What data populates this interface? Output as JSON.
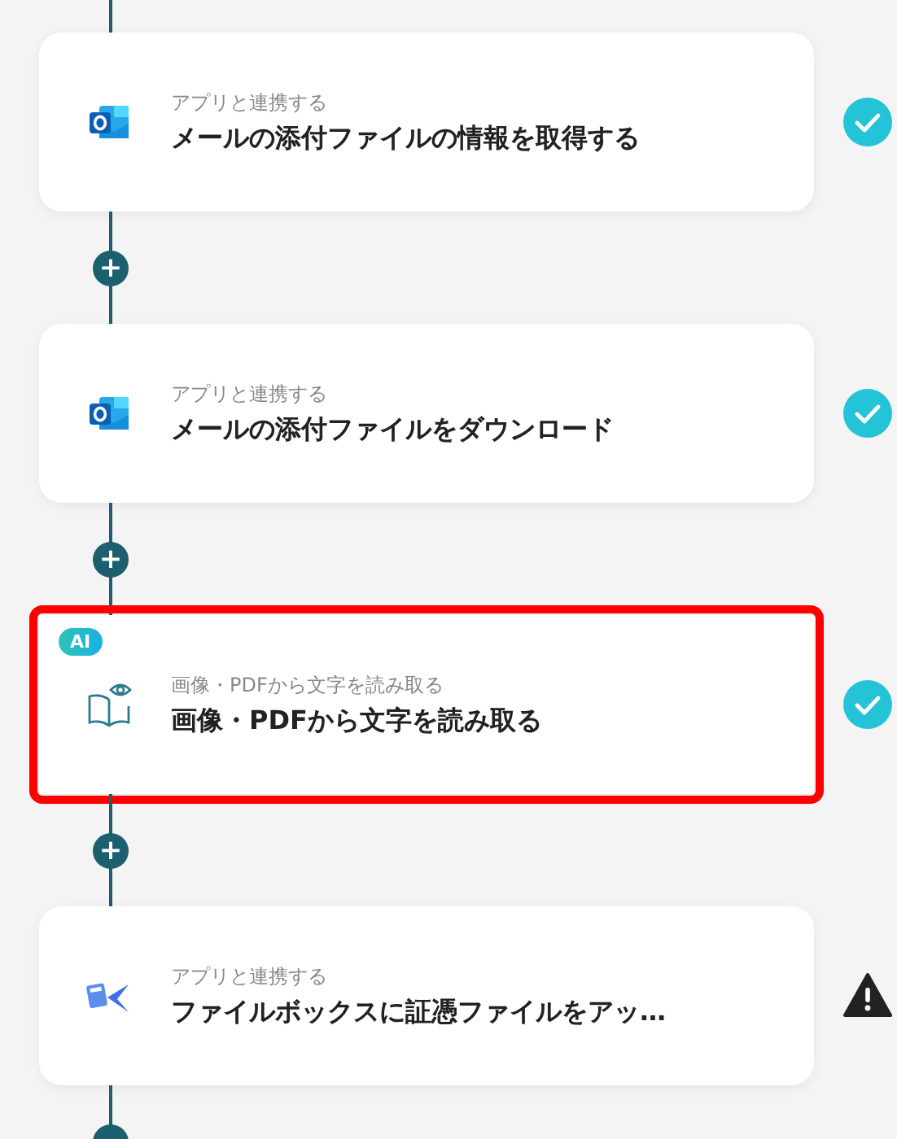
{
  "steps": [
    {
      "kind": "mail",
      "subtitle": "アプリと連携する",
      "title": "メールの添付ファイルの情報を取得する",
      "complete": true,
      "highlighted": false
    },
    {
      "kind": "mail",
      "subtitle": "アプリと連携する",
      "title": "メールの添付ファイルをダウンロード",
      "complete": true,
      "highlighted": false
    },
    {
      "kind": "ocr",
      "badge": "AI",
      "subtitle": "画像・PDFから文字を読み取る",
      "title": "画像・PDFから文字を読み取る",
      "complete": true,
      "highlighted": true
    },
    {
      "kind": "filebox",
      "subtitle": "アプリと連携する",
      "title": "ファイルボックスに証憑ファイルをアッ…",
      "complete": false,
      "highlighted": false
    }
  ],
  "add_buttons": [
    "+",
    "+",
    "+"
  ]
}
